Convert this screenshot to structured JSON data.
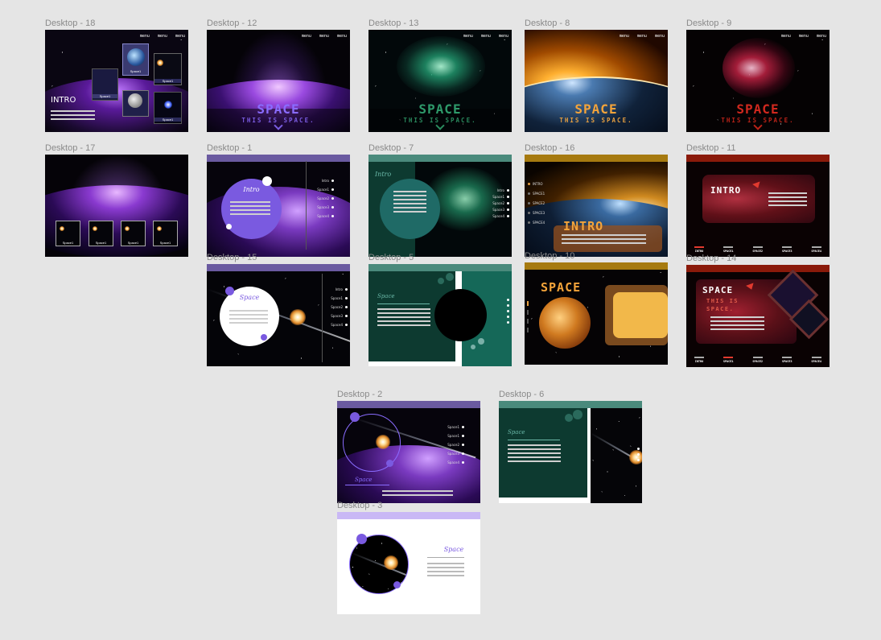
{
  "canvas_bg": "#e5e5e5",
  "frames": [
    {
      "id": "desktop-18",
      "label": "Desktop - 18"
    },
    {
      "id": "desktop-12",
      "label": "Desktop - 12"
    },
    {
      "id": "desktop-13",
      "label": "Desktop - 13"
    },
    {
      "id": "desktop-8",
      "label": "Desktop - 8"
    },
    {
      "id": "desktop-9",
      "label": "Desktop - 9"
    },
    {
      "id": "desktop-17",
      "label": "Desktop - 17"
    },
    {
      "id": "desktop-1",
      "label": "Desktop - 1"
    },
    {
      "id": "desktop-7",
      "label": "Desktop - 7"
    },
    {
      "id": "desktop-16",
      "label": "Desktop - 16"
    },
    {
      "id": "desktop-11",
      "label": "Desktop - 11"
    },
    {
      "id": "desktop-15",
      "label": "Desktop - 15"
    },
    {
      "id": "desktop-5",
      "label": "Desktop - 5"
    },
    {
      "id": "desktop-10",
      "label": "Desktop - 10"
    },
    {
      "id": "desktop-14",
      "label": "Desktop - 14"
    },
    {
      "id": "desktop-2",
      "label": "Desktop - 2"
    },
    {
      "id": "desktop-6",
      "label": "Desktop - 6"
    },
    {
      "id": "desktop-3",
      "label": "Desktop - 3"
    }
  ],
  "menu_labels": [
    "menu",
    "menu",
    "menu"
  ],
  "hero": {
    "title": "SPACE",
    "subtitle": "THIS IS SPACE.",
    "colors": {
      "purple": "#7c5cf0",
      "green": "#2e9a6a",
      "orange": "#f4a43a",
      "red": "#d0281e"
    }
  },
  "intro": {
    "title": "INTRO",
    "script_title": "Intro"
  },
  "space_script": "Space",
  "space_nav": [
    "Intro",
    "Space1",
    "Space2",
    "Space3",
    "Space4"
  ],
  "space_nav_short": [
    "Space1",
    "Space2",
    "Space3",
    "Space4"
  ],
  "tabs_red": [
    "INTRO",
    "SPACE1",
    "SPACE2",
    "SPACE3",
    "SPACE4"
  ],
  "tabs_gold": [
    "INTRO",
    "SPACE1",
    "SPACE2",
    "SPACE3",
    "SPACE4"
  ],
  "thumb_label": "Space1",
  "card_labels": [
    "Space1",
    "Space1",
    "Space1",
    "Space1"
  ],
  "theme": {
    "purple_bar": "#6a5aa0",
    "teal_bar": "#4a8a7c",
    "teal_dark": "#0d3a30",
    "gold_bar": "#a67a10",
    "red_bar": "#8a1a0a",
    "lavender_bar": "#c9b8f5"
  }
}
